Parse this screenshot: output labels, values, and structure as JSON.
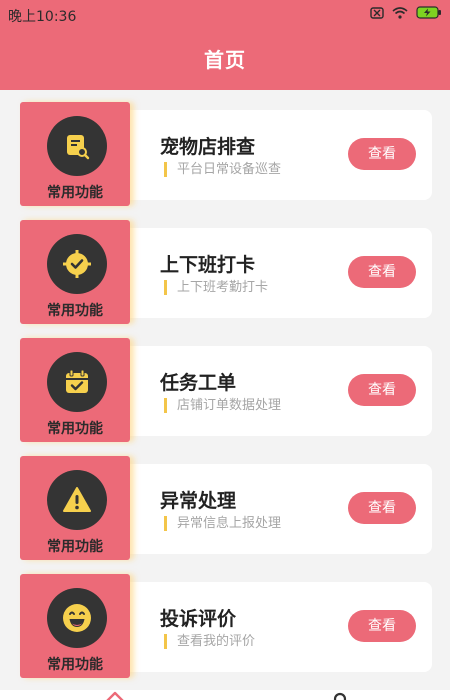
{
  "status_bar": {
    "time": "晚上10:36"
  },
  "header": {
    "title": "首页"
  },
  "colors": {
    "accent": "#ec6a78",
    "badge_circle": "#343434",
    "icon_yellow": "#f6d04d",
    "divider_yellow": "#f3c549"
  },
  "items": [
    {
      "icon": "inspection-document-icon",
      "badge": "常用功能",
      "title": "宠物店排查",
      "subtitle": "平台日常设备巡查",
      "button": "查看"
    },
    {
      "icon": "clock-check-icon",
      "badge": "常用功能",
      "title": "上下班打卡",
      "subtitle": "上下班考勤打卡",
      "button": "查看"
    },
    {
      "icon": "calendar-check-icon",
      "badge": "常用功能",
      "title": "任务工单",
      "subtitle": "店铺订单数据处理",
      "button": "查看"
    },
    {
      "icon": "warning-icon",
      "badge": "常用功能",
      "title": "异常处理",
      "subtitle": "异常信息上报处理",
      "button": "查看"
    },
    {
      "icon": "smile-icon",
      "badge": "常用功能",
      "title": "投诉评价",
      "subtitle": "查看我的评价",
      "button": "查看"
    }
  ],
  "tab_bar": {
    "tabs": [
      {
        "icon": "home-icon"
      },
      {
        "icon": "user-icon"
      }
    ]
  }
}
